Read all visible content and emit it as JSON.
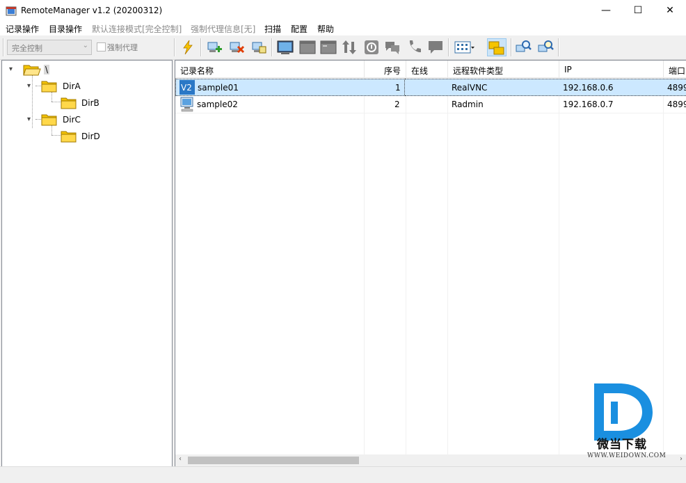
{
  "window": {
    "title": "RemoteManager v1.2 (20200312)",
    "minimize": "—",
    "maximize": "☐",
    "close": "✕"
  },
  "menu": [
    {
      "label": "记录操作",
      "disabled": false
    },
    {
      "label": "目录操作",
      "disabled": false
    },
    {
      "label": "默认连接模式[完全控制]",
      "disabled": true
    },
    {
      "label": "强制代理信息[无]",
      "disabled": true
    },
    {
      "label": "扫描",
      "disabled": false
    },
    {
      "label": "配置",
      "disabled": false
    },
    {
      "label": "帮助",
      "disabled": false
    }
  ],
  "toolbar": {
    "mode_select": "完全控制",
    "force_proxy_label": "强制代理",
    "force_proxy_checked": false,
    "buttons": [
      "connect-icon",
      "add-record-icon",
      "delete-record-icon",
      "edit-record-icon",
      "screen-icon",
      "window-icon",
      "window2-icon",
      "transfer-icon",
      "info-icon",
      "chat-icon",
      "phone-icon",
      "message-icon",
      "view-mode-icon",
      "folder-view-icon",
      "search-icon",
      "search-find-icon"
    ]
  },
  "tree": {
    "root": "\\",
    "nodes": [
      {
        "label": "DirA",
        "children": [
          "DirB"
        ]
      },
      {
        "label": "DirC",
        "children": [
          "DirD"
        ]
      }
    ]
  },
  "list": {
    "columns": [
      "记录名称",
      "序号",
      "在线",
      "远程软件类型",
      "IP",
      "端口"
    ],
    "rows": [
      {
        "name": "sample01",
        "index": "1",
        "online": "",
        "type": "RealVNC",
        "ip": "192.168.0.6",
        "port": "4899",
        "icon": "vnc-icon",
        "selected": true
      },
      {
        "name": "sample02",
        "index": "2",
        "online": "",
        "type": "Radmin",
        "ip": "192.168.0.7",
        "port": "4899",
        "icon": "computer-icon",
        "selected": false
      }
    ]
  },
  "watermark": {
    "brand": "微当下载",
    "url": "WWW.WEIDOWN.COM"
  },
  "colors": {
    "selection": "#cce8ff",
    "folder": "#f5c400",
    "watermark_blue": "#1a8fe0"
  }
}
